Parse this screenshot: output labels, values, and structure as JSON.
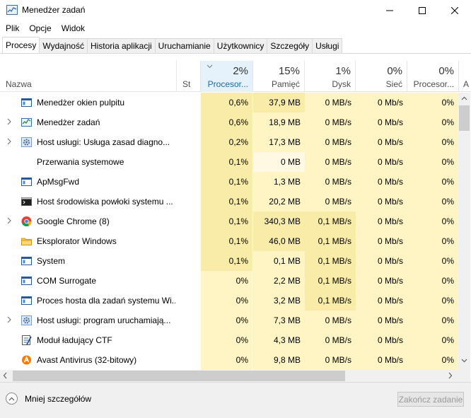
{
  "window": {
    "title": "Menedżer zadań"
  },
  "menu": [
    "Plik",
    "Opcje",
    "Widok"
  ],
  "tabs": [
    "Procesy",
    "Wydajność",
    "Historia aplikacji",
    "Uruchamianie",
    "Użytkownicy",
    "Szczegóły",
    "Usługi"
  ],
  "active_tab": "Procesy",
  "columns": {
    "name": "Nazwa",
    "status": "St",
    "cpu": {
      "pct": "2%",
      "label": "Procesor..."
    },
    "mem": {
      "pct": "15%",
      "label": "Pamięć"
    },
    "disk": {
      "pct": "1%",
      "label": "Dysk"
    },
    "net": {
      "pct": "0%",
      "label": "Sieć"
    },
    "gpu": {
      "pct": "0%",
      "label": "Procesor..."
    },
    "more": "A"
  },
  "processes": [
    {
      "name": "Menedżer okien pulpitu",
      "expandable": false,
      "icon": "window-icon",
      "cpu": "0,6%",
      "mem": "37,9 MB",
      "disk": "0 MB/s",
      "net": "0 Mb/s",
      "gpu": "0%"
    },
    {
      "name": "Menedżer zadań",
      "expandable": true,
      "icon": "task-manager-icon",
      "cpu": "0,6%",
      "mem": "18,9 MB",
      "disk": "0 MB/s",
      "net": "0 Mb/s",
      "gpu": "0%"
    },
    {
      "name": "Host usługi: Usługa zasad diagno...",
      "expandable": true,
      "icon": "gear-icon",
      "cpu": "0,2%",
      "mem": "17,3 MB",
      "disk": "0 MB/s",
      "net": "0 Mb/s",
      "gpu": "0%"
    },
    {
      "name": "Przerwania systemowe",
      "expandable": false,
      "icon": "blank-icon",
      "cpu": "0,1%",
      "mem": "0 MB",
      "disk": "0 MB/s",
      "net": "0 Mb/s",
      "gpu": "0%"
    },
    {
      "name": "ApMsgFwd",
      "expandable": false,
      "icon": "window-icon",
      "cpu": "0,1%",
      "mem": "1,3 MB",
      "disk": "0 MB/s",
      "net": "0 Mb/s",
      "gpu": "0%"
    },
    {
      "name": "Host środowiska powłoki systemu ...",
      "expandable": false,
      "icon": "console-icon",
      "cpu": "0,1%",
      "mem": "20,2 MB",
      "disk": "0 MB/s",
      "net": "0 Mb/s",
      "gpu": "0%"
    },
    {
      "name": "Google Chrome (8)",
      "expandable": true,
      "icon": "chrome-icon",
      "cpu": "0,1%",
      "mem": "340,3 MB",
      "disk": "0,1 MB/s",
      "net": "0 Mb/s",
      "gpu": "0%"
    },
    {
      "name": "Eksplorator Windows",
      "expandable": false,
      "icon": "folder-icon",
      "cpu": "0,1%",
      "mem": "46,0 MB",
      "disk": "0,1 MB/s",
      "net": "0 Mb/s",
      "gpu": "0%"
    },
    {
      "name": "System",
      "expandable": false,
      "icon": "window-icon",
      "cpu": "0,1%",
      "mem": "0,1 MB",
      "disk": "0,1 MB/s",
      "net": "0 Mb/s",
      "gpu": "0%"
    },
    {
      "name": "COM Surrogate",
      "expandable": false,
      "icon": "window-icon",
      "cpu": "0%",
      "mem": "2,2 MB",
      "disk": "0,1 MB/s",
      "net": "0 Mb/s",
      "gpu": "0%"
    },
    {
      "name": "Proces hosta dla zadań systemu Wi...",
      "expandable": false,
      "icon": "window-icon",
      "cpu": "0%",
      "mem": "3,2 MB",
      "disk": "0,1 MB/s",
      "net": "0 Mb/s",
      "gpu": "0%"
    },
    {
      "name": "Host usługi: program uruchamiają...",
      "expandable": true,
      "icon": "gear-icon",
      "cpu": "0%",
      "mem": "7,3 MB",
      "disk": "0 MB/s",
      "net": "0 Mb/s",
      "gpu": "0%"
    },
    {
      "name": "Moduł ładujący CTF",
      "expandable": false,
      "icon": "ctf-icon",
      "cpu": "0%",
      "mem": "4,3 MB",
      "disk": "0 MB/s",
      "net": "0 Mb/s",
      "gpu": "0%"
    },
    {
      "name": "Avast Antivirus (32-bitowy)",
      "expandable": false,
      "icon": "avast-icon",
      "cpu": "0%",
      "mem": "9,8 MB",
      "disk": "0 MB/s",
      "net": "0 Mb/s",
      "gpu": "0%"
    }
  ],
  "heat": [
    {
      "cpu": 2,
      "mem": 2,
      "disk": 1,
      "net": 1,
      "gpu": 1
    },
    {
      "cpu": 2,
      "mem": 1,
      "disk": 1,
      "net": 1,
      "gpu": 1
    },
    {
      "cpu": 2,
      "mem": 1,
      "disk": 1,
      "net": 1,
      "gpu": 1
    },
    {
      "cpu": 2,
      "mem": 0,
      "disk": 1,
      "net": 1,
      "gpu": 1
    },
    {
      "cpu": 2,
      "mem": 1,
      "disk": 1,
      "net": 1,
      "gpu": 1
    },
    {
      "cpu": 2,
      "mem": 1,
      "disk": 1,
      "net": 1,
      "gpu": 1
    },
    {
      "cpu": 2,
      "mem": 2,
      "disk": 2,
      "net": 1,
      "gpu": 1
    },
    {
      "cpu": 2,
      "mem": 2,
      "disk": 2,
      "net": 1,
      "gpu": 1
    },
    {
      "cpu": 2,
      "mem": 1,
      "disk": 2,
      "net": 1,
      "gpu": 1
    },
    {
      "cpu": 1,
      "mem": 1,
      "disk": 2,
      "net": 1,
      "gpu": 1
    },
    {
      "cpu": 1,
      "mem": 1,
      "disk": 2,
      "net": 1,
      "gpu": 1
    },
    {
      "cpu": 1,
      "mem": 1,
      "disk": 1,
      "net": 1,
      "gpu": 1
    },
    {
      "cpu": 1,
      "mem": 1,
      "disk": 1,
      "net": 1,
      "gpu": 1
    },
    {
      "cpu": 1,
      "mem": 1,
      "disk": 1,
      "net": 1,
      "gpu": 1
    }
  ],
  "footer": {
    "less_details": "Mniej szczegółów",
    "end_task": "Zakończ zadanie"
  },
  "colors": {
    "heat_low": "#fff9e3",
    "heat_mid": "#fff4c4",
    "heat_high": "#f9eca8",
    "sorted_header": "#e5f1fb"
  }
}
